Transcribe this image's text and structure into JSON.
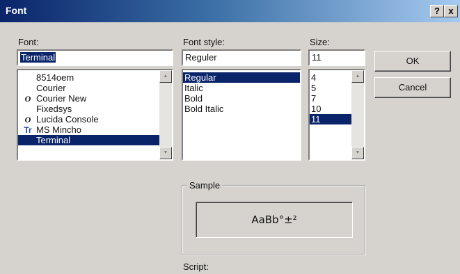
{
  "window": {
    "title": "Font",
    "help_label": "?",
    "close_label": "x",
    "accent": "#0a246a",
    "background": "#d6d3ce"
  },
  "font": {
    "label": "Font:",
    "value": "Terminal",
    "options": [
      {
        "name": "8514oem",
        "icon": ""
      },
      {
        "name": "Courier",
        "icon": ""
      },
      {
        "name": "Courier New",
        "icon": "O"
      },
      {
        "name": "Fixedsys",
        "icon": ""
      },
      {
        "name": "Lucida Console",
        "icon": "O"
      },
      {
        "name": "MS Mincho",
        "icon": "Tr"
      },
      {
        "name": "Terminal",
        "icon": ""
      }
    ],
    "selected_index": 6
  },
  "style": {
    "label": "Font style:",
    "value": "Reguler",
    "options": [
      "Regular",
      "Italic",
      "Bold",
      "Bold Italic"
    ],
    "selected_index": 0
  },
  "size": {
    "label": "Size:",
    "value": "11",
    "options": [
      "4",
      "5",
      "7",
      "10",
      "11"
    ],
    "selected_index": 4
  },
  "buttons": {
    "ok": "OK",
    "cancel": "Cancel"
  },
  "sample": {
    "label": "Sample",
    "text": "AaBb°±²"
  },
  "script": {
    "label": "Script:"
  }
}
